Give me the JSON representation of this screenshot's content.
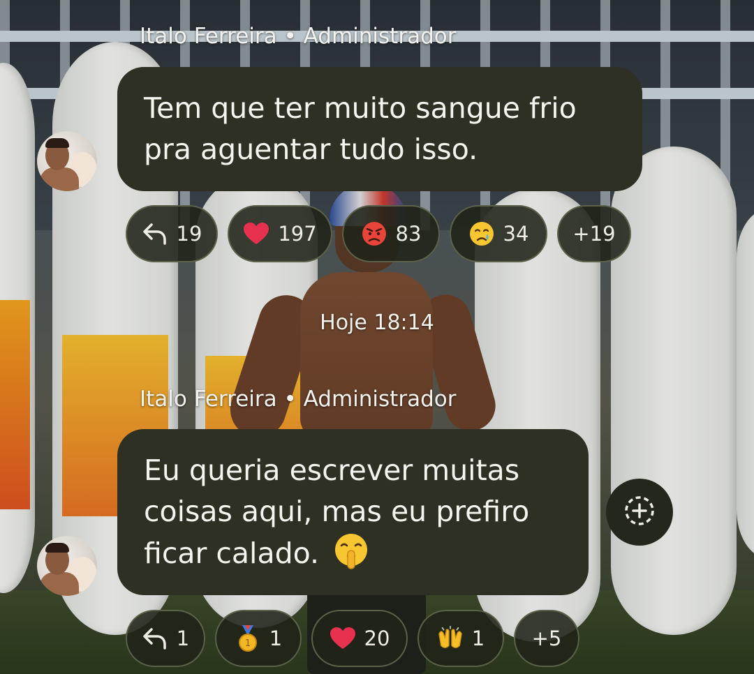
{
  "messages": [
    {
      "sender": "Italo Ferreira • Administrador",
      "lines": [
        "Tem que ter muito sangue frio",
        "pra aguentar tudo isso."
      ],
      "reactions": [
        {
          "icon": "reply-icon",
          "count": "19"
        },
        {
          "icon": "heart-icon",
          "count": "197"
        },
        {
          "icon": "angry-face-icon",
          "count": "83"
        },
        {
          "icon": "crying-face-icon",
          "count": "34"
        }
      ],
      "more": "+19"
    },
    {
      "sender": "Italo Ferreira • Administrador",
      "lines": [
        "Eu queria escrever muitas",
        "coisas aqui, mas eu prefiro",
        "ficar calado."
      ],
      "trailing_emoji": "shushing-face-icon",
      "reactions": [
        {
          "icon": "reply-icon",
          "count": "1"
        },
        {
          "icon": "medal-icon",
          "count": "1"
        },
        {
          "icon": "heart-icon",
          "count": "20"
        },
        {
          "icon": "raising-hands-icon",
          "count": "1"
        }
      ],
      "more": "+5"
    }
  ],
  "timestamp": "Hoje 18:14",
  "add_reaction_icon": "add-reaction-icon",
  "colors": {
    "bubble_bg": "#2d3022",
    "pill_border": "#5c6149",
    "text": "#f5f5ef",
    "heart": "#e8314f"
  }
}
